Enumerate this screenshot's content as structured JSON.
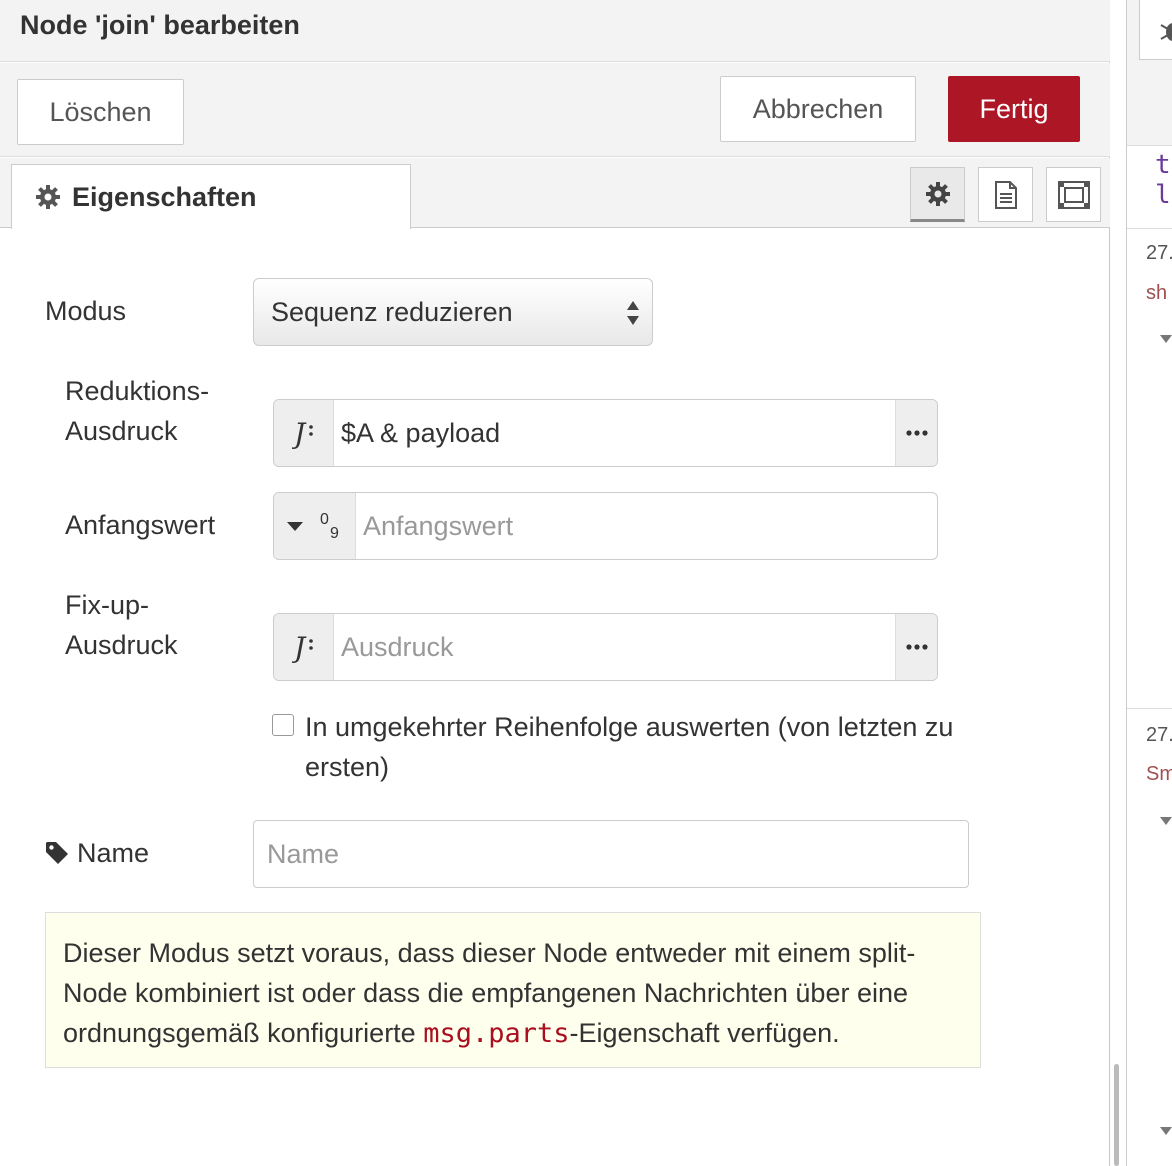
{
  "dialog": {
    "title": "Node 'join' bearbeiten",
    "buttons": {
      "delete": "Löschen",
      "cancel": "Abbrechen",
      "done": "Fertig"
    },
    "tabs": {
      "properties": "Eigenschaften",
      "icons": [
        "gear-icon",
        "description-icon",
        "appearance-icon"
      ]
    }
  },
  "form": {
    "mode": {
      "label": "Modus",
      "value": "Sequenz reduzieren"
    },
    "reduce_expression": {
      "label_line1": "Reduktions-",
      "label_line2": "Ausdruck",
      "value": "$A & payload"
    },
    "initial_value": {
      "label": "Anfangswert",
      "placeholder": "Anfangswert"
    },
    "fixup_expression": {
      "label_line1": "Fix-up-",
      "label_line2": "Ausdruck",
      "placeholder": "Ausdruck"
    },
    "reverse_order": {
      "label": "In umgekehrter Reihenfolge auswerten (von letzten zu ersten)",
      "checked": false
    },
    "name": {
      "label": "Name",
      "placeholder": "Name"
    }
  },
  "tip": {
    "text_before": "Dieser Modus setzt voraus, dass dieser Node entweder mit einem split-Node kombiniert ist oder dass die empfangenen Nachrichten über eine ordnungsgemäß konfigurierte ",
    "code": "msg.parts",
    "text_after": "-Eigenschaft verfügen."
  },
  "side_panel": {
    "code_lines": [
      "t",
      "l"
    ],
    "entries": [
      {
        "timestamp": "27.",
        "topic": "sh"
      },
      {
        "timestamp": "27.",
        "topic": "Sm"
      }
    ]
  },
  "colors": {
    "primary": "#ad1625",
    "tip_background": "#ffffee",
    "code": "#aa0f1f"
  }
}
